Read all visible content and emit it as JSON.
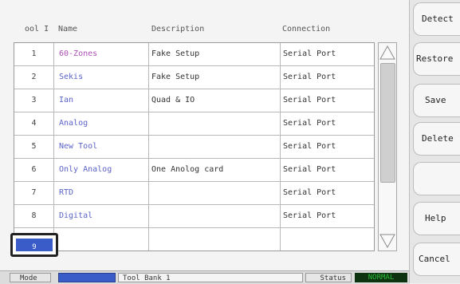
{
  "columns": {
    "tool": "ool I",
    "name": "Name",
    "description": "Description",
    "connection": "Connection"
  },
  "rows": [
    {
      "index": "1",
      "name": "60-Zones",
      "description": "Fake Setup",
      "connection": "Serial Port"
    },
    {
      "index": "2",
      "name": "Sekis",
      "description": "Fake Setup",
      "connection": "Serial Port"
    },
    {
      "index": "3",
      "name": "Ian",
      "description": "Quad & IO",
      "connection": "Serial Port"
    },
    {
      "index": "4",
      "name": "Analog",
      "description": "",
      "connection": "Serial Port"
    },
    {
      "index": "5",
      "name": "New Tool",
      "description": "",
      "connection": "Serial Port"
    },
    {
      "index": "6",
      "name": "Only Analog",
      "description": "One Anolog card",
      "connection": "Serial Port"
    },
    {
      "index": "7",
      "name": "RTD",
      "description": "",
      "connection": "Serial Port"
    },
    {
      "index": "8",
      "name": "Digital",
      "description": "",
      "connection": "Serial Port"
    }
  ],
  "selected_row": {
    "index": "9"
  },
  "status_bar": {
    "mode_label": "Mode",
    "bank": "Tool Bank 1",
    "status_label": "Status",
    "status_value": "NORMAL"
  },
  "sidebar": {
    "detect": "Detect",
    "restore": "Restore",
    "save": "Save",
    "delete": "Delete",
    "blank": "",
    "help": "Help",
    "cancel": "Cancel"
  },
  "colors": {
    "accent_blue": "#3a5cc8",
    "name_text": "#5b63c9",
    "name_text_first": "#b04fb8",
    "status_ok": "#2dbb3a",
    "status_bg": "#0d3310"
  },
  "icons": {
    "scroll_up": "triangle-up-icon",
    "scroll_down": "triangle-down-icon"
  }
}
